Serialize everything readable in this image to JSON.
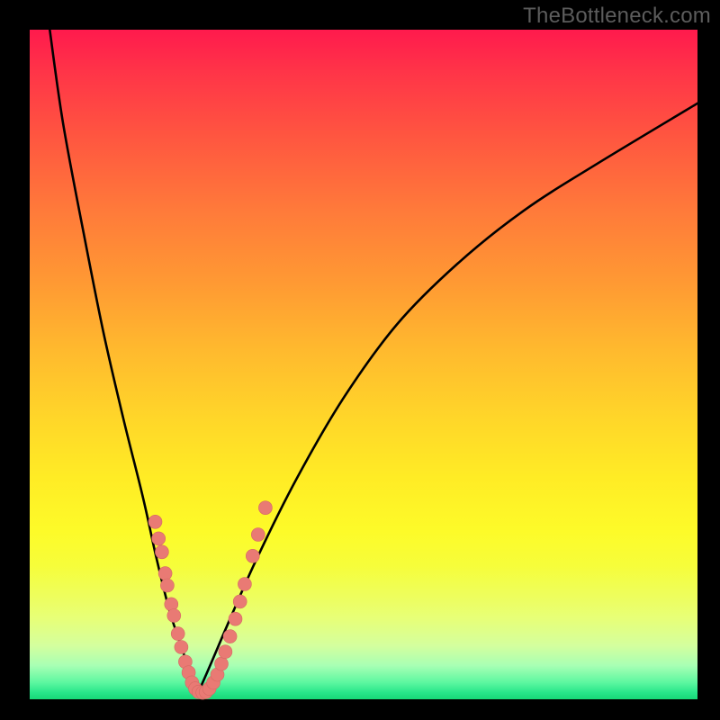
{
  "watermark": "TheBottleneck.com",
  "colors": {
    "dot_fill": "#e97a74",
    "dot_stroke": "#d46a63",
    "curve": "#000000"
  },
  "chart_data": {
    "type": "line",
    "title": "",
    "xlabel": "",
    "ylabel": "",
    "xlim": [
      0,
      100
    ],
    "ylim": [
      0,
      100
    ],
    "note": "Axes are normalized 0–100; y increases upward. Curve is a V-shaped bottleneck curve with minimum near x≈25, y≈0.",
    "series": [
      {
        "name": "left-branch",
        "x": [
          3,
          5,
          8,
          11,
          14,
          17,
          19,
          21,
          23,
          24,
          25
        ],
        "y": [
          100,
          86,
          70,
          55,
          42,
          30,
          21,
          13,
          7,
          3,
          0.5
        ]
      },
      {
        "name": "right-branch",
        "x": [
          25,
          27,
          30,
          34,
          40,
          47,
          55,
          64,
          74,
          85,
          100
        ],
        "y": [
          0.5,
          5,
          12,
          21,
          33,
          45,
          56,
          65,
          73,
          80,
          89
        ]
      }
    ],
    "points": {
      "name": "sample-dots",
      "note": "Pink sample dots clustered near the trough of the curve",
      "xy": [
        [
          18.8,
          26.5
        ],
        [
          19.3,
          24.0
        ],
        [
          19.8,
          22.0
        ],
        [
          20.3,
          18.8
        ],
        [
          20.6,
          17.0
        ],
        [
          21.2,
          14.2
        ],
        [
          21.6,
          12.5
        ],
        [
          22.2,
          9.8
        ],
        [
          22.7,
          7.8
        ],
        [
          23.3,
          5.6
        ],
        [
          23.8,
          4.0
        ],
        [
          24.3,
          2.5
        ],
        [
          24.8,
          1.6
        ],
        [
          25.3,
          1.1
        ],
        [
          25.9,
          1.0
        ],
        [
          26.4,
          1.1
        ],
        [
          26.9,
          1.6
        ],
        [
          27.5,
          2.5
        ],
        [
          28.1,
          3.7
        ],
        [
          28.7,
          5.3
        ],
        [
          29.3,
          7.1
        ],
        [
          30.0,
          9.4
        ],
        [
          30.8,
          12.0
        ],
        [
          31.5,
          14.6
        ],
        [
          32.2,
          17.2
        ],
        [
          33.4,
          21.4
        ],
        [
          34.2,
          24.6
        ],
        [
          35.3,
          28.6
        ]
      ]
    }
  }
}
